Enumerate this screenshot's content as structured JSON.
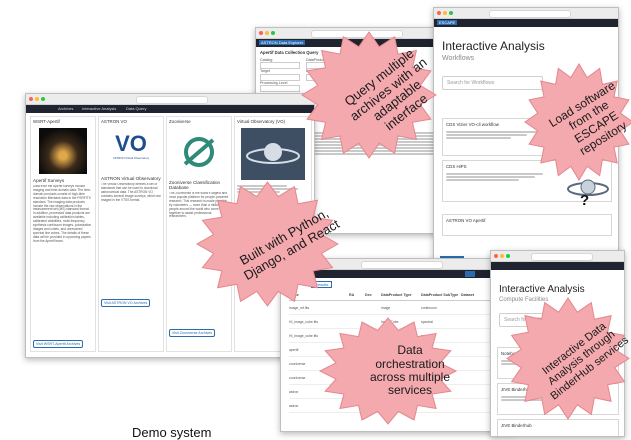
{
  "caption": "Demo system",
  "callouts": [
    {
      "id": "query",
      "text": "Query multiple archives with an adaptable interface"
    },
    {
      "id": "load",
      "text": "Load software from the ESCAPE repository"
    },
    {
      "id": "built",
      "text": "Built with Python, Django, and React"
    },
    {
      "id": "orchestration",
      "text": "Data orchestration across multiple services"
    },
    {
      "id": "binderhub",
      "text": "Interactive Data Analysis through BinderHub services"
    }
  ],
  "landing": {
    "nav_items": [
      "Archives",
      "Interactive Analysis",
      "Data Query"
    ],
    "columns": [
      {
        "heading": "WSRT-Apertif",
        "title": "Apertif Surveys",
        "button": "Visit WSRT-Apertif Archives",
        "description": "Data from the Apertif surveys include imaging and time-domain data. The time-domain products consist of high-time resolution filterbank data in the PSRFITS standard. The imaging data products include the raw observations in the measurement set (MS) standard format. In addition, processed data products are available including calibration tables, calibrated visibilities, multi-frequency synthesis continuum images, polarization images and cubes, and unresolved spectral line cubes. The details of these data will be provided in upcoming papers from the Apertif team."
      },
      {
        "heading": "ASTRON VO",
        "title": "ASTRON Virtual Observatory",
        "button": "Visit ASTRON VO Archives",
        "logo_top": "VO",
        "logo_sub": "ASTRON Virtual Observatory",
        "description": "The Virtual Observatory defines a set of standards that can be used to download astronomical data. The ASTRON VO contains several image surveys, which are imaged in the VTSS format."
      },
      {
        "heading": "Zooniverse",
        "title": "Zooniverse Classification Database",
        "button": "Visit Zooniverse Archives",
        "description": "The Zooniverse is the world's largest and most popular platform for people-powered research. This research is made possible by volunteers — more than a million people around the world who come together to assist professional researchers."
      },
      {
        "heading": "Virtual Observatory (VO)",
        "title": "",
        "button": "",
        "description": ""
      }
    ]
  },
  "query_window": {
    "brand": "ASTRON Data Explorer",
    "title": "Apertif Data Collection Query",
    "labels": [
      "Catalog",
      "Target",
      "Processing Level",
      "DataProduct Type",
      "DataProduct SubType"
    ]
  },
  "workflows": {
    "brand": "ESCAPE",
    "title": "Interactive Analysis",
    "subtitle": "Workflows",
    "search_placeholder": "Search for Workflows",
    "items": [
      {
        "title": "CDS Vizier VO-cli workflow"
      },
      {
        "title": "CDS HiPS"
      },
      {
        "title": "ASTRON VO Apertif"
      }
    ]
  },
  "facilities": {
    "title": "Interactive Analysis",
    "subtitle": "Compute Facilities",
    "search_placeholder": "Search for Facilities",
    "items": [
      {
        "title": "Notebook"
      },
      {
        "title": "JIVE Binderhub"
      },
      {
        "title": "JIVE Binderhub"
      }
    ]
  },
  "results_window": {
    "tab_label": "Results",
    "headers": [
      "Name",
      "RA",
      "Dec",
      "DataProduct Type",
      "DataProduct SubType",
      "Dataset"
    ],
    "rows": [
      {
        "name": "image_mf.fits",
        "ra": "",
        "dec": "",
        "type": "image",
        "subtype": "continuum"
      },
      {
        "name": "HI_image_cube.fits",
        "ra": "",
        "dec": "",
        "type": "ImageCube",
        "subtype": "spectral"
      },
      {
        "name": "HI_image_cube.fits",
        "ra": "",
        "dec": "",
        "type": "ImageCube",
        "subtype": "spectral"
      },
      {
        "name": "apertif",
        "ra": "",
        "dec": "",
        "type": "ImageCube",
        "subtype": "spectral"
      },
      {
        "name": "zooniverse",
        "ra": "",
        "dec": "",
        "type": "",
        "subtype": ""
      },
      {
        "name": "zooniverse",
        "ra": "",
        "dec": "",
        "type": "",
        "subtype": ""
      },
      {
        "name": "astron",
        "ra": "",
        "dec": "",
        "type": "",
        "subtype": ""
      },
      {
        "name": "astron",
        "ra": "",
        "dec": "",
        "type": "",
        "subtype": ""
      }
    ]
  },
  "colors": {
    "burst_fill": "#f3a9ad",
    "burst_stroke": "#e4878d",
    "navbar": "#1f2430",
    "link_blue": "#2b6cb0"
  }
}
